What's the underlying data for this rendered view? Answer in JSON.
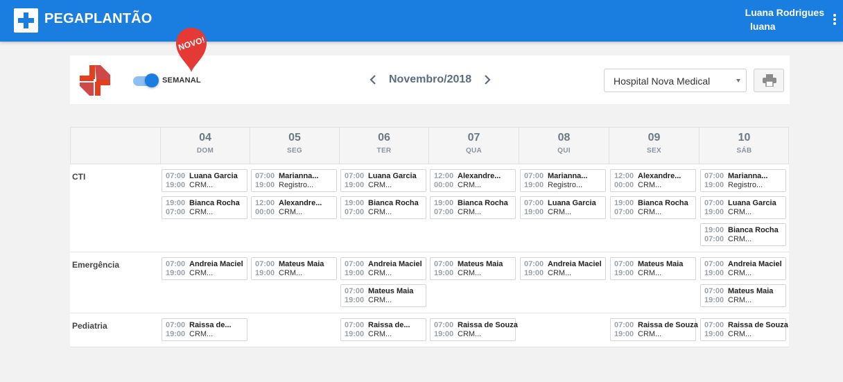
{
  "app": {
    "brand": "PEGAPLANTÃO",
    "user_name": "Luana Rodrigues",
    "user_login": "luana"
  },
  "toolbar": {
    "toggle_label": "SEMANAL",
    "toggle_on": true,
    "badge": "NOVO!",
    "month": "Novembro/2018",
    "hospital": "Hospital Nova Medical"
  },
  "days": [
    {
      "num": "04",
      "wd": "DOM"
    },
    {
      "num": "05",
      "wd": "SEG"
    },
    {
      "num": "06",
      "wd": "TER"
    },
    {
      "num": "07",
      "wd": "QUA"
    },
    {
      "num": "08",
      "wd": "QUI"
    },
    {
      "num": "09",
      "wd": "SEX"
    },
    {
      "num": "10",
      "wd": "SÁB"
    }
  ],
  "sections": [
    {
      "name": "CTI",
      "shifts": [
        {
          "day": 0,
          "slot": 0,
          "t1": "07:00",
          "name": "Luana Garcia",
          "t2": "19:00",
          "sub": "CRM..."
        },
        {
          "day": 0,
          "slot": 1,
          "t1": "19:00",
          "name": "Bianca Rocha",
          "t2": "07:00",
          "sub": "CRM..."
        },
        {
          "day": 1,
          "slot": 0,
          "t1": "07:00",
          "name": "Marianna...",
          "t2": "19:00",
          "sub": "Registro..."
        },
        {
          "day": 1,
          "slot": 1,
          "t1": "12:00",
          "name": "Alexandre...",
          "t2": "00:00",
          "sub": "CRM..."
        },
        {
          "day": 2,
          "slot": 0,
          "t1": "07:00",
          "name": "Luana Garcia",
          "t2": "19:00",
          "sub": "CRM..."
        },
        {
          "day": 2,
          "slot": 1,
          "t1": "19:00",
          "name": "Bianca Rocha",
          "t2": "07:00",
          "sub": "CRM..."
        },
        {
          "day": 3,
          "slot": 0,
          "t1": "12:00",
          "name": "Alexandre...",
          "t2": "00:00",
          "sub": "CRM..."
        },
        {
          "day": 3,
          "slot": 1,
          "t1": "19:00",
          "name": "Bianca Rocha",
          "t2": "07:00",
          "sub": "CRM..."
        },
        {
          "day": 4,
          "slot": 0,
          "t1": "07:00",
          "name": "Marianna...",
          "t2": "19:00",
          "sub": "Registro..."
        },
        {
          "day": 4,
          "slot": 1,
          "t1": "07:00",
          "name": "Luana Garcia",
          "t2": "19:00",
          "sub": "CRM..."
        },
        {
          "day": 5,
          "slot": 0,
          "t1": "12:00",
          "name": "Alexandre...",
          "t2": "00:00",
          "sub": "CRM..."
        },
        {
          "day": 5,
          "slot": 1,
          "t1": "19:00",
          "name": "Bianca Rocha",
          "t2": "07:00",
          "sub": "CRM..."
        },
        {
          "day": 6,
          "slot": 0,
          "t1": "07:00",
          "name": "Marianna...",
          "t2": "19:00",
          "sub": "Registro..."
        },
        {
          "day": 6,
          "slot": 1,
          "t1": "07:00",
          "name": "Luana Garcia",
          "t2": "19:00",
          "sub": "CRM..."
        },
        {
          "day": 6,
          "slot": 2,
          "t1": "19:00",
          "name": "Bianca Rocha",
          "t2": "07:00",
          "sub": "CRM..."
        }
      ]
    },
    {
      "name": "Emergência",
      "shifts": [
        {
          "day": 0,
          "slot": 0,
          "t1": "07:00",
          "name": "Andreia Maciel",
          "t2": "19:00",
          "sub": "CRM..."
        },
        {
          "day": 1,
          "slot": 0,
          "t1": "07:00",
          "name": "Mateus Maia",
          "t2": "19:00",
          "sub": "CRM..."
        },
        {
          "day": 2,
          "slot": 0,
          "t1": "07:00",
          "name": "Andreia Maciel",
          "t2": "19:00",
          "sub": "CRM..."
        },
        {
          "day": 2,
          "slot": 1,
          "t1": "07:00",
          "name": "Mateus Maia",
          "t2": "19:00",
          "sub": "CRM..."
        },
        {
          "day": 3,
          "slot": 0,
          "t1": "07:00",
          "name": "Mateus Maia",
          "t2": "19:00",
          "sub": "CRM..."
        },
        {
          "day": 4,
          "slot": 0,
          "t1": "07:00",
          "name": "Andreia Maciel",
          "t2": "19:00",
          "sub": "CRM..."
        },
        {
          "day": 5,
          "slot": 0,
          "t1": "07:00",
          "name": "Mateus Maia",
          "t2": "19:00",
          "sub": "CRM..."
        },
        {
          "day": 6,
          "slot": 0,
          "t1": "07:00",
          "name": "Andreia Maciel",
          "t2": "19:00",
          "sub": "CRM..."
        },
        {
          "day": 6,
          "slot": 1,
          "t1": "07:00",
          "name": "Mateus Maia",
          "t2": "19:00",
          "sub": "CRM..."
        }
      ]
    },
    {
      "name": "Pediatria",
      "shifts": [
        {
          "day": 0,
          "slot": 0,
          "t1": "07:00",
          "name": "Raissa de...",
          "t2": "19:00",
          "sub": "CRM..."
        },
        {
          "day": 2,
          "slot": 0,
          "t1": "07:00",
          "name": "Raissa de...",
          "t2": "19:00",
          "sub": "CRM..."
        },
        {
          "day": 3,
          "slot": 0,
          "t1": "07:00",
          "name": "Raissa de Souza",
          "t2": "19:00",
          "sub": "CRM..."
        },
        {
          "day": 5,
          "slot": 0,
          "t1": "07:00",
          "name": "Raissa de Souza",
          "t2": "19:00",
          "sub": "CRM..."
        },
        {
          "day": 6,
          "slot": 0,
          "t1": "07:00",
          "name": "Raissa de Souza",
          "t2": "19:00",
          "sub": "CRM..."
        }
      ]
    }
  ],
  "colors": {
    "primary": "#1a7de0",
    "badge": "#e53935",
    "hospital_logo": "#e53e1d"
  },
  "icons": [
    "cross-logo-icon",
    "hospital-cross-icon",
    "chevron-left-icon",
    "chevron-right-icon",
    "printer-icon",
    "more-vert-icon"
  ]
}
